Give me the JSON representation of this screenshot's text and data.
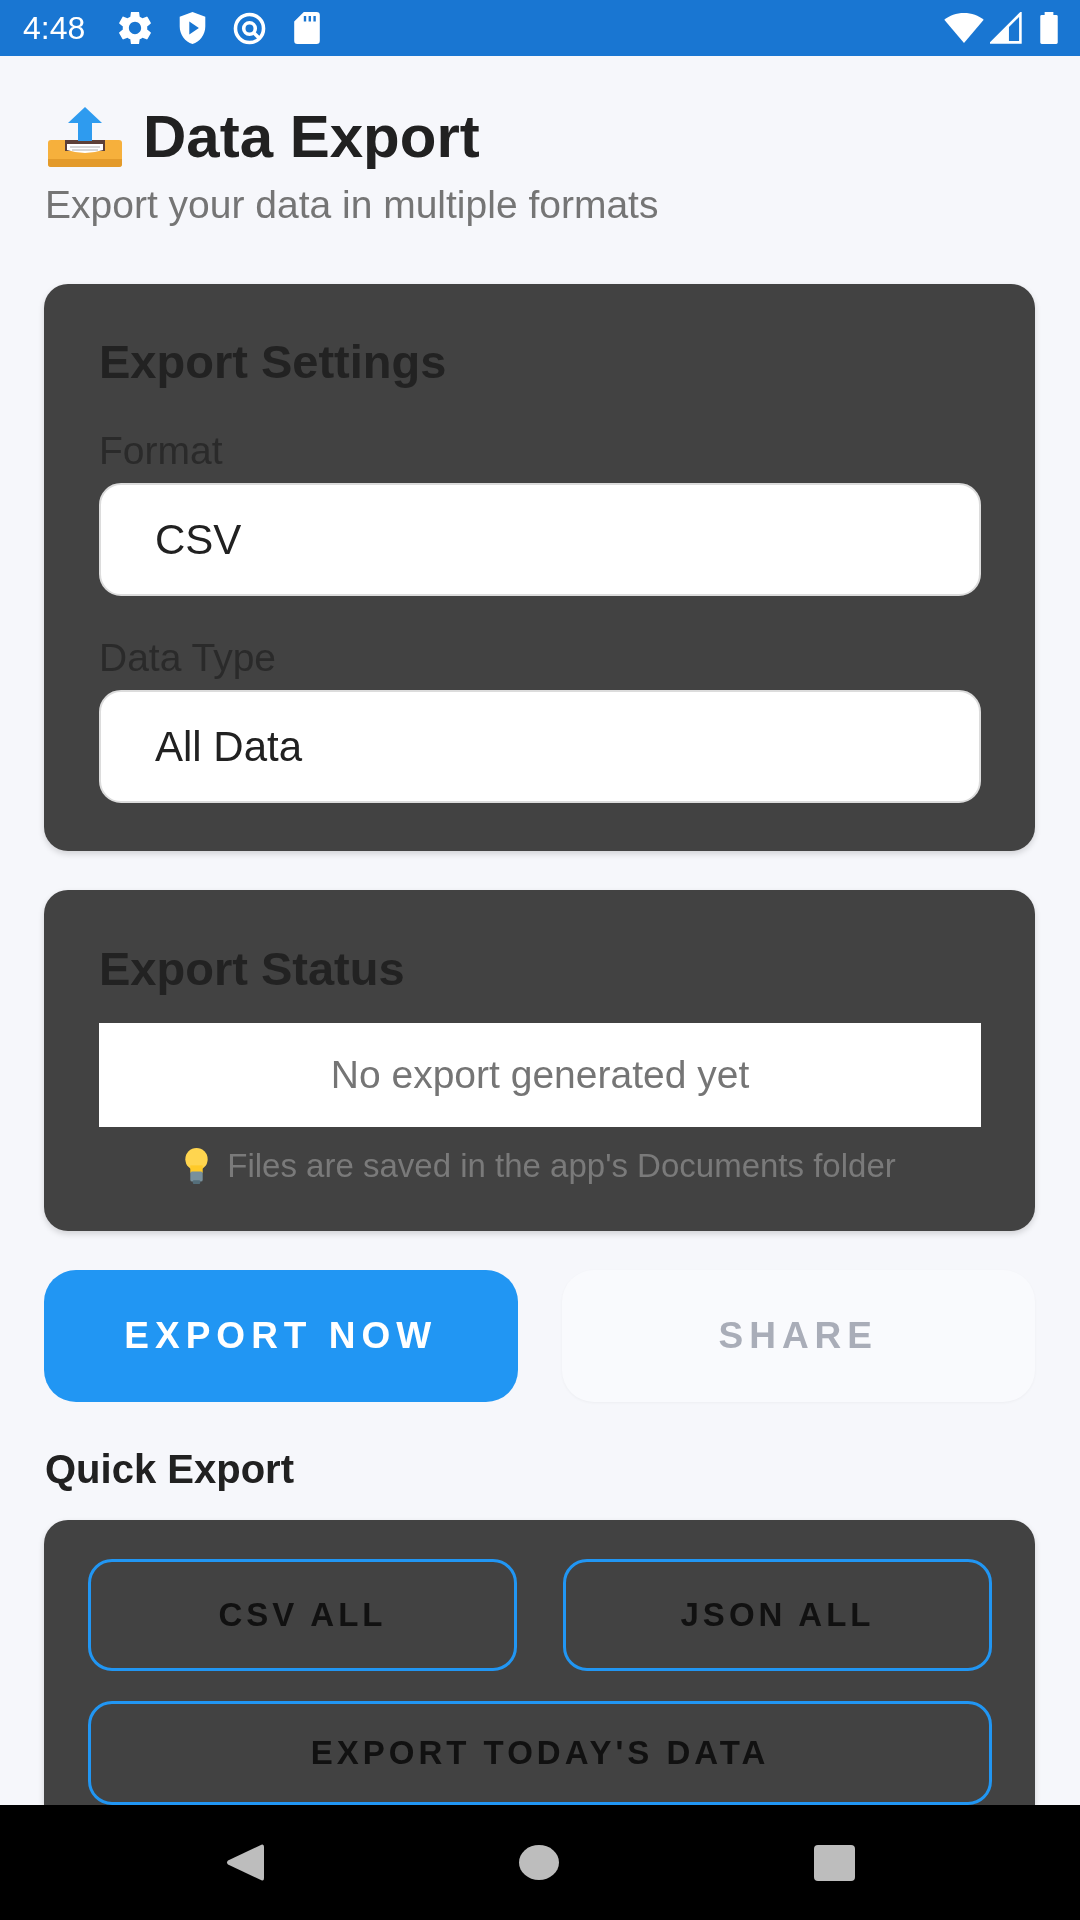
{
  "status_bar": {
    "time": "4:48"
  },
  "header": {
    "title": "Data Export",
    "subtitle": "Export your data in multiple formats"
  },
  "export_settings": {
    "title": "Export Settings",
    "fields": [
      {
        "label": "Format",
        "value": "CSV"
      },
      {
        "label": "Data Type",
        "value": "All Data"
      }
    ]
  },
  "export_status": {
    "title": "Export Status",
    "message": "No export generated yet",
    "hint": "Files are saved in the app's Documents folder"
  },
  "actions": [
    {
      "label": "EXPORT NOW",
      "disabled": false
    },
    {
      "label": "SHARE",
      "disabled": true
    }
  ],
  "quick_export": {
    "title": "Quick Export",
    "buttons": [
      {
        "label": "CSV ALL"
      },
      {
        "label": "JSON ALL"
      },
      {
        "label": "EXPORT TODAY'S DATA"
      }
    ]
  }
}
